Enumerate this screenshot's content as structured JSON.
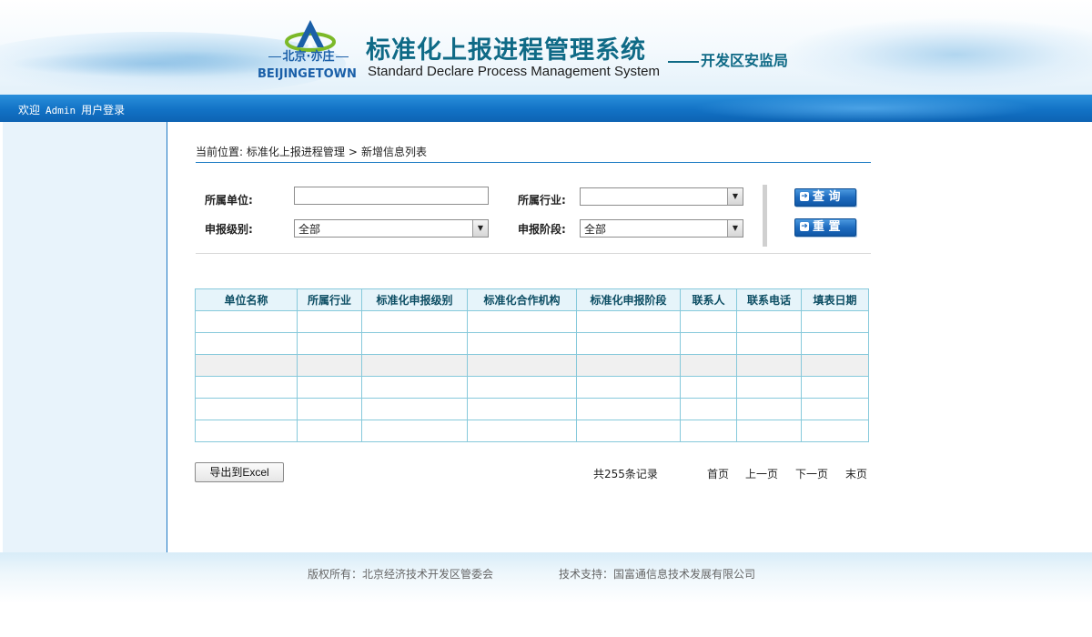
{
  "header": {
    "logo_city": "北京·亦庄",
    "logo_en": "BEIJINGETOWN",
    "title": "标准化上报进程管理系统",
    "subtitle": "Standard Declare Process Management System",
    "org": "开发区安监局"
  },
  "topbar": {
    "welcome": "欢迎",
    "user": "Admin",
    "login": "用户登录"
  },
  "breadcrumb": {
    "prefix": "当前位置:",
    "level1": "标准化上报进程管理",
    "separator": ">",
    "level2": "新增信息列表"
  },
  "search": {
    "unit_label": "所属单位:",
    "unit_value": "",
    "industry_label": "所属行业:",
    "industry_value": "",
    "level_label": "申报级别:",
    "level_value": "全部",
    "stage_label": "申报阶段:",
    "stage_value": "全部",
    "query_button": "查 询",
    "reset_button": "重 置"
  },
  "table": {
    "columns": [
      "单位名称",
      "所属行业",
      "标准化申报级别",
      "标准化合作机构",
      "标准化申报阶段",
      "联系人",
      "联系电话",
      "填表日期"
    ],
    "rows": [
      [
        "",
        "",
        "",
        "",
        "",
        "",
        "",
        ""
      ],
      [
        "",
        "",
        "",
        "",
        "",
        "",
        "",
        ""
      ],
      [
        "",
        "",
        "",
        "",
        "",
        "",
        "",
        ""
      ],
      [
        "",
        "",
        "",
        "",
        "",
        "",
        "",
        ""
      ],
      [
        "",
        "",
        "",
        "",
        "",
        "",
        "",
        ""
      ],
      [
        "",
        "",
        "",
        "",
        "",
        "",
        "",
        ""
      ]
    ]
  },
  "actions": {
    "export": "导出到Excel"
  },
  "pagination": {
    "total": "共255条记录",
    "first": "首页",
    "prev": "上一页",
    "next": "下一页",
    "last": "末页"
  },
  "footer": {
    "copyright": "版权所有：北京经济技术开发区管委会",
    "support": "技术支持：国富通信息技术发展有限公司"
  },
  "colors": {
    "brand_blue": "#1272c5",
    "title_teal": "#0f6a86",
    "table_border": "#86c9db"
  }
}
